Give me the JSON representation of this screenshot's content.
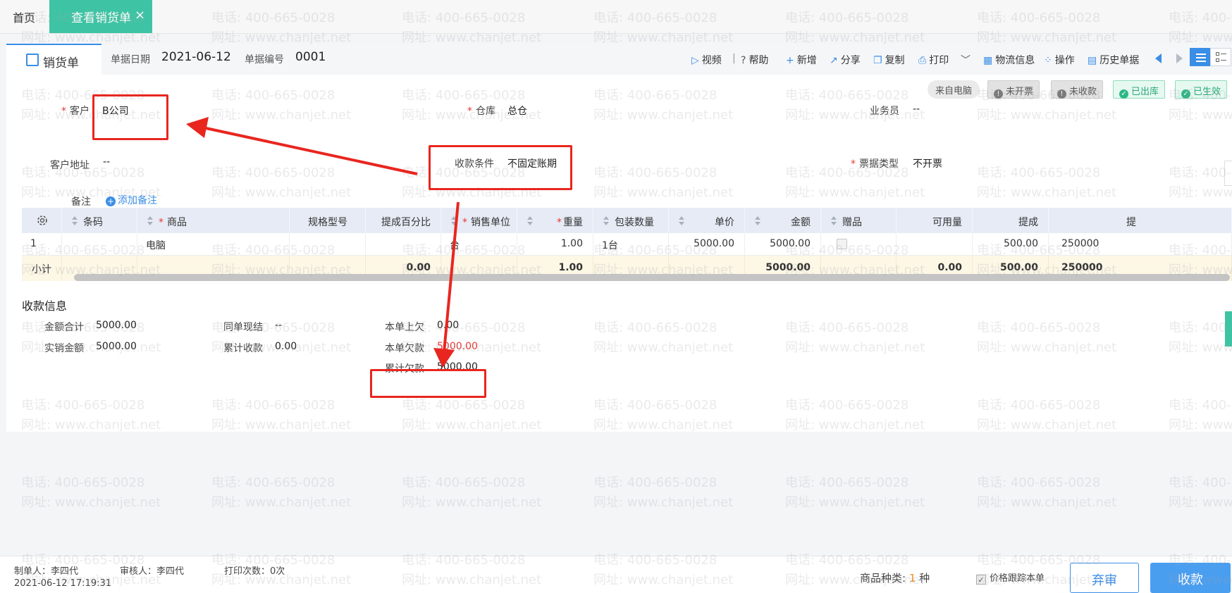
{
  "watermark": {
    "line1": "电话: 400-665-0028",
    "line2": "网址: www.chanjet.net"
  },
  "tabs": {
    "home": "首页",
    "active": "查看销货单",
    "close": "×"
  },
  "doc": {
    "tab_label": "销货单",
    "date_label": "单据日期",
    "date_value": "2021-06-12",
    "number_label": "单据编号",
    "number_value": "0001"
  },
  "toolbar": {
    "video": "视频",
    "help": "帮助",
    "add": "新增",
    "share": "分享",
    "copy": "复制",
    "print": "打印",
    "logistics": "物流信息",
    "operate": "操作",
    "history": "历史单据"
  },
  "badges": {
    "source": "来自电脑",
    "not_invoiced": "未开票",
    "not_collected": "未收款",
    "shipped": "已出库",
    "effective": "已生效"
  },
  "form": {
    "customer_label": "客户",
    "customer_value": "B公司",
    "warehouse_label": "仓库",
    "warehouse_value": "总仓",
    "salesperson_label": "业务员",
    "salesperson_value": "--",
    "address_label": "客户地址",
    "address_value": "--",
    "payment_label": "收款条件",
    "payment_value": "不固定账期",
    "invoice_type_label": "票据类型",
    "invoice_type_value": "不开票",
    "note_label": "备注",
    "add_note": "添加备注"
  },
  "table": {
    "headers": [
      "条码",
      "商品",
      "规格型号",
      "提成百分比",
      "销售单位",
      "重量",
      "包装数量",
      "单价",
      "金额",
      "赠品",
      "可用量",
      "提成",
      "提"
    ],
    "row": {
      "index": "1",
      "product": "电脑",
      "unit": "台",
      "weight": "1.00",
      "pack_qty": "1台",
      "unit_price": "5000.00",
      "amount": "5000.00",
      "commission": "500.00",
      "last": "250000"
    },
    "subtotal": {
      "label": "小计",
      "commission_pct": "0.00",
      "weight": "1.00",
      "amount": "5000.00",
      "available": "0.00",
      "commission": "500.00",
      "last": "250000"
    }
  },
  "collection": {
    "title": "收款信息",
    "amount_total_label": "金额合计",
    "amount_total": "5000.00",
    "same_settle_label": "同单现结",
    "same_settle": "--",
    "prev_debt_label": "本单上欠",
    "prev_debt": "0.00",
    "actual_sales_label": "实销金额",
    "actual_sales": "5000.00",
    "cum_received_label": "累计收款",
    "cum_received": "0.00",
    "this_debt_label": "本单欠款",
    "this_debt": "5000.00",
    "cum_debt_label": "累计欠款",
    "cum_debt": "5000.00"
  },
  "footer": {
    "maker": "制单人：李四代",
    "reviewer": "审核人：李四代",
    "print_count": "打印次数：0次",
    "timestamp": "2021-06-12 17:19:31",
    "kinds_label": "商品种类:",
    "kinds_count": "1",
    "kinds_unit": "种",
    "price_track": "价格跟踪本单",
    "abandon": "弃审",
    "collect": "收款"
  },
  "colors": {
    "accent": "#3a8ee6",
    "tab_active": "#3ec4a4",
    "callout": "#e8261f",
    "debt": "#e53935"
  }
}
